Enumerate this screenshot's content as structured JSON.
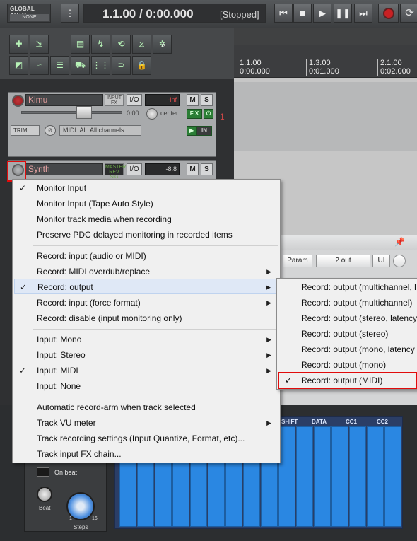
{
  "transport": {
    "global_auto_title": "GLOBAL AUTO",
    "global_auto_mode": "NONE",
    "time": "1.1.00 / 0:00.000",
    "state": "[Stopped]",
    "buttons": [
      "prev",
      "stop",
      "play",
      "pause",
      "next",
      "record",
      "loop"
    ]
  },
  "tracks": [
    {
      "name": "Kimu",
      "fx_tag": "INPUT FX",
      "io": "I/O",
      "volume": "-inf",
      "mute": "M",
      "solo": "S",
      "pan_value": "0.00",
      "pan_label": "center",
      "fx": "F X",
      "trim": "TRIM",
      "midi_input": "MIDI: All: All channels",
      "in_label": "IN",
      "number": "1"
    },
    {
      "name": "Synth",
      "fx_tag": "MASTER REV SIG",
      "io": "I/O",
      "volume": "-8.8",
      "mute": "M",
      "solo": "S"
    }
  ],
  "ruler": {
    "marks": [
      {
        "bar": "1.1.00",
        "time": "0:00.000"
      },
      {
        "bar": "1.3.00",
        "time": "0:01.000"
      },
      {
        "bar": "2.1.00",
        "time": "0:02.000"
      }
    ]
  },
  "fx_window": {
    "param": "Param",
    "out": "2 out",
    "ui": "UI"
  },
  "menu": {
    "items": [
      {
        "label": "Monitor Input",
        "checked": true
      },
      {
        "label": "Monitor Input (Tape Auto Style)"
      },
      {
        "label": "Monitor track media when recording"
      },
      {
        "label": "Preserve PDC delayed monitoring in recorded items"
      },
      {
        "label": "Record: input (audio or MIDI)"
      },
      {
        "label": "Record: MIDI overdub/replace",
        "sub": true
      },
      {
        "label": "Record: output",
        "checked": true,
        "sub": true,
        "selected": true
      },
      {
        "label": "Record: input (force format)",
        "sub": true
      },
      {
        "label": "Record: disable (input monitoring only)"
      },
      {
        "label": "Input: Mono",
        "sub": true
      },
      {
        "label": "Input: Stereo",
        "sub": true
      },
      {
        "label": "Input: MIDI",
        "checked": true,
        "sub": true
      },
      {
        "label": "Input: None"
      },
      {
        "label": "Automatic record-arm when track selected"
      },
      {
        "label": "Track VU meter",
        "sub": true
      },
      {
        "label": "Track recording settings (Input Quantize, Format, etc)..."
      },
      {
        "label": "Track input FX chain..."
      }
    ]
  },
  "submenu": {
    "items": [
      {
        "label": "Record: output (multichannel, l"
      },
      {
        "label": "Record: output (multichannel)"
      },
      {
        "label": "Record: output (stereo, latency"
      },
      {
        "label": "Record: output (stereo)"
      },
      {
        "label": "Record: output (mono, latency"
      },
      {
        "label": "Record: output (mono)"
      },
      {
        "label": "Record: output (MIDI)",
        "checked": true
      }
    ]
  },
  "synth": {
    "columns": [
      "SHIFT",
      "DATA",
      "CC1",
      "CC2"
    ],
    "on_beat": "On beat",
    "beat": "Beat",
    "steps": "Steps",
    "steps_min": "1",
    "steps_max": "16"
  },
  "colors": {
    "highlight": "#e10b0b",
    "menu_bg": "#f0f0f0",
    "seq_blue": "#2a87e2"
  }
}
